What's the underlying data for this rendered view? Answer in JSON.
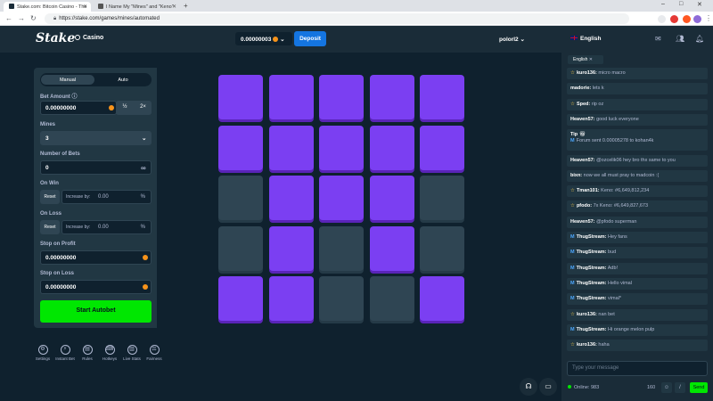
{
  "browser": {
    "tabs": [
      {
        "title": "Stake.com: Bitcoin Casino - The"
      },
      {
        "title": "I Name My \"Mines\" and \"Keno\""
      }
    ],
    "new_tab": "+",
    "url": "https://stake.com/games/mines/automated",
    "window_controls": [
      "–",
      "□",
      "✕"
    ]
  },
  "header": {
    "logo": "Stake",
    "casino": "Casino",
    "balance": "0.00000003",
    "deposit": "Deposit",
    "username": "polorl2",
    "language": "English"
  },
  "panel": {
    "modes": [
      "Manual",
      "Auto"
    ],
    "active_mode": "Auto",
    "bet_amount_label": "Bet Amount",
    "bet_amount": "0.00000000",
    "half": "½",
    "double": "2×",
    "mines_label": "Mines",
    "mines_value": "3",
    "num_bets_label": "Number of Bets",
    "num_bets": "0",
    "infinity": "∞",
    "on_win_label": "On Win",
    "on_loss_label": "On Loss",
    "reset": "Reset",
    "increase_by": "Increase by:",
    "percent_value": "0.00",
    "percent_sign": "%",
    "stop_profit_label": "Stop on Profit",
    "stop_profit": "0.00000000",
    "stop_loss_label": "Stop on Loss",
    "stop_loss": "0.00000000",
    "start_button": "Start Autobet"
  },
  "board": {
    "rows": [
      [
        "gem",
        "gem",
        "gem",
        "gem",
        "gem"
      ],
      [
        "gem",
        "gem",
        "gem",
        "gem",
        "gem"
      ],
      [
        "revealed",
        "gem",
        "gem",
        "gem",
        "revealed"
      ],
      [
        "revealed",
        "gem",
        "revealed",
        "gem",
        "revealed"
      ],
      [
        "gem",
        "gem",
        "revealed",
        "revealed",
        "gem"
      ]
    ]
  },
  "footer": {
    "items": [
      "Settings",
      "Instant Bet",
      "Rules",
      "Hotkeys",
      "Live Stats",
      "Fairness"
    ]
  },
  "chat": {
    "tab": "English",
    "messages": [
      {
        "user": "kuro136:",
        "text": "micro macro",
        "star": true
      },
      {
        "user": "madorie:",
        "text": "lets k"
      },
      {
        "user": "Sped:",
        "text": "rip oz",
        "star": true
      },
      {
        "user": "Heaven57:",
        "text": "good luck everyone"
      },
      {
        "user": "Tip",
        "text": "Forum sent 0.00005278 to kohan4k",
        "tip": true
      },
      {
        "user": "Heaven57:",
        "text": "@ozcelik06 hey bro thx same to you"
      },
      {
        "user": "bixn:",
        "text": "now we all must pray to madcoin :("
      },
      {
        "user": "Tman101:",
        "text": "Keno: #6,649,812,234",
        "star": true
      },
      {
        "user": "pfodo:",
        "text": "7x Keno: #6,649,827,673",
        "star": true
      },
      {
        "user": "Heaven57:",
        "text": "@pfodo superman"
      },
      {
        "user": "ThugStream:",
        "text": "Hey fans",
        "mod": true
      },
      {
        "user": "ThugStream:",
        "text": "bud",
        "mod": true
      },
      {
        "user": "ThugStream:",
        "text": "Adb!",
        "mod": true
      },
      {
        "user": "ThugStream:",
        "text": "Hello vimal",
        "mod": true
      },
      {
        "user": "ThugStream:",
        "text": "vimal*",
        "mod": true
      },
      {
        "user": "kuro136:",
        "text": "nan bet",
        "star": true
      },
      {
        "user": "ThugStream:",
        "text": "Hi orange melon pulp",
        "mod": true
      },
      {
        "user": "kuro136:",
        "text": "haha",
        "star": true
      }
    ],
    "input_placeholder": "Type your message",
    "online_label": "Online: 983",
    "char_count": "160",
    "send": "Send"
  }
}
